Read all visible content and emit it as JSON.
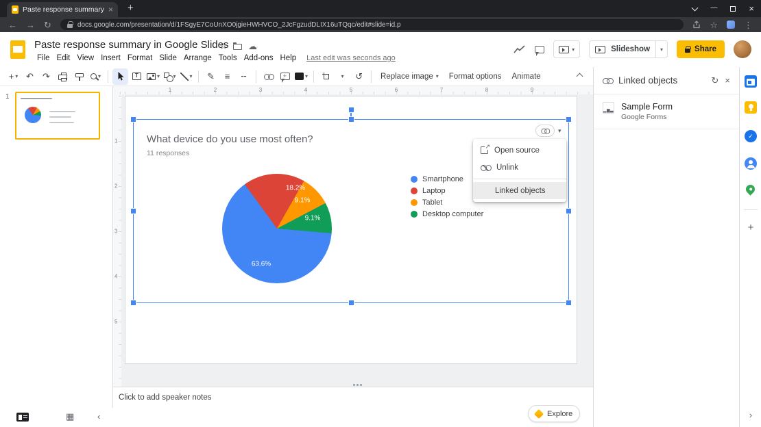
{
  "browser": {
    "tab_title": "Paste response summary in Goo",
    "url": "docs.google.com/presentation/d/1FSgyE7CoUnXO0jgieHWHVCO_2JcFgzudDLIX16uTQqc/edit#slide=id.p"
  },
  "header": {
    "doc_title": "Paste response summary in Google Slides",
    "menus": [
      "File",
      "Edit",
      "View",
      "Insert",
      "Format",
      "Slide",
      "Arrange",
      "Tools",
      "Add-ons",
      "Help"
    ],
    "last_edit": "Last edit was seconds ago",
    "slideshow_label": "Slideshow",
    "share_label": "Share"
  },
  "toolbar": {
    "replace_image_label": "Replace image",
    "format_options_label": "Format options",
    "animate_label": "Animate"
  },
  "filmstrip": {
    "slide_number": "1"
  },
  "rulers": {
    "horizontal": [
      "1",
      "2",
      "3",
      "4",
      "5",
      "6",
      "7",
      "8",
      "9"
    ],
    "vertical": [
      "1",
      "2",
      "3",
      "4",
      "5"
    ]
  },
  "chart_data": {
    "type": "pie",
    "title": "What device do you use most often?",
    "subtitle": "11 responses",
    "categories": [
      "Smartphone",
      "Laptop",
      "Tablet",
      "Desktop computer"
    ],
    "values": [
      63.6,
      18.2,
      9.1,
      9.1
    ],
    "slice_labels": [
      "63.6%",
      "18.2%",
      "9.1%",
      "9.1%"
    ],
    "colors": [
      "#4285f4",
      "#db4437",
      "#ff9800",
      "#109d58"
    ],
    "legend_position": "right",
    "start_angle_deg": 95
  },
  "context_menu": {
    "items": [
      {
        "label": "Open source",
        "icon": "open-source",
        "separator_before": false,
        "highlighted": false
      },
      {
        "label": "Unlink",
        "icon": "unlink",
        "separator_before": false,
        "highlighted": false
      },
      {
        "label": "Linked objects",
        "icon": "none",
        "separator_before": true,
        "highlighted": true
      }
    ]
  },
  "linked_objects_panel": {
    "title": "Linked objects",
    "item_title": "Sample Form",
    "item_subtitle": "Google Forms"
  },
  "notes": {
    "placeholder": "Click to add speaker notes"
  },
  "explore_label": "Explore",
  "colors": {
    "accent_blue": "#4285f4",
    "share_yellow": "#fbbc04"
  }
}
